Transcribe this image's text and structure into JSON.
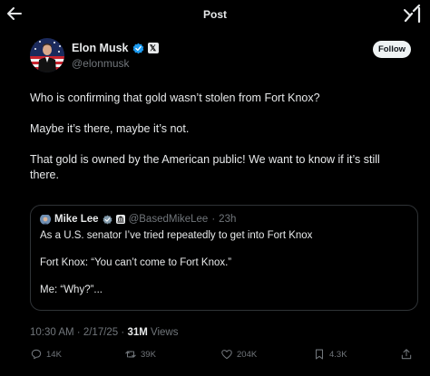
{
  "header": {
    "title": "Post"
  },
  "author": {
    "display_name": "Elon Musk",
    "handle": "@elonmusk",
    "badge_label": "𝕏"
  },
  "follow_label": "Follow",
  "tweet": {
    "paragraphs": [
      "Who is confirming that gold wasn’t stolen from Fort Knox?",
      "Maybe it’s there, maybe it’s not.",
      "That gold is owned by the American public! We want to know if it’s still there."
    ]
  },
  "quote": {
    "display_name": "Mike Lee",
    "handle": "@BasedMikeLee",
    "separator": "·",
    "time": "23h",
    "paragraphs": [
      "As a U.S. senator I’ve tried repeatedly to get into Fort Knox",
      "Fort Knox: “You can’t come to Fort Knox.”",
      "Me: “Why?”..."
    ]
  },
  "meta": {
    "time": "10:30 AM",
    "separator": " · ",
    "date": "2/17/25",
    "views_count": "31M",
    "views_label": " Views"
  },
  "actions": {
    "replies": "14K",
    "reposts": "39K",
    "likes": "204K",
    "bookmarks": "4.3K"
  },
  "colors": {
    "background": "#000000",
    "text": "#e7e9ea",
    "muted": "#71767b",
    "border": "#2f3336",
    "verified": "#1d9bf0"
  }
}
